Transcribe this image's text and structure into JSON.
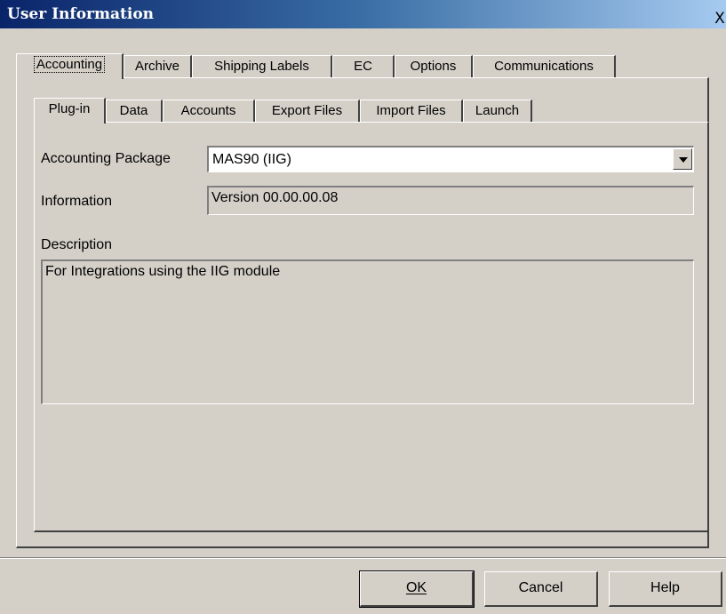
{
  "window": {
    "title": "User Information",
    "close_symbol": "X"
  },
  "outer_tabs": [
    {
      "label": "Accounting",
      "selected": true
    },
    {
      "label": "Archive"
    },
    {
      "label": "Shipping Labels"
    },
    {
      "label": "EC"
    },
    {
      "label": "Options"
    },
    {
      "label": "Communications"
    }
  ],
  "inner_tabs": [
    {
      "label": "Plug-in",
      "selected": true
    },
    {
      "label": "Data"
    },
    {
      "label": "Accounts"
    },
    {
      "label": "Export Files"
    },
    {
      "label": "Import Files"
    },
    {
      "label": "Launch"
    }
  ],
  "form": {
    "accounting_package_label": "Accounting Package",
    "accounting_package_value": "MAS90 (IIG)",
    "information_label": "Information",
    "information_value": "Version 00.00.00.08",
    "description_label": "Description",
    "description_value": "For Integrations using the IIG module"
  },
  "buttons": {
    "ok": "OK",
    "cancel": "Cancel",
    "help": "Help"
  }
}
